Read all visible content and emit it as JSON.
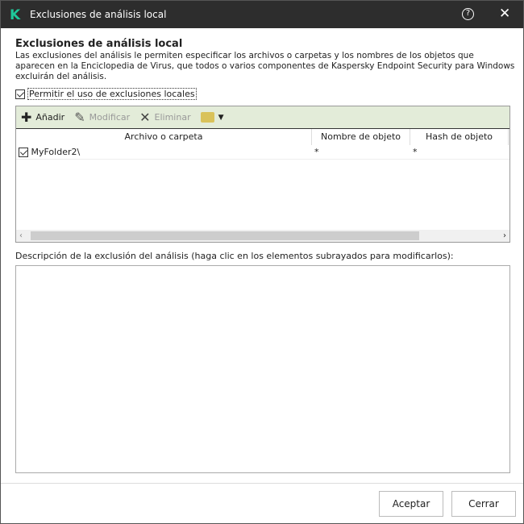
{
  "window": {
    "title": "Exclusiones de análisis local",
    "logo": "K"
  },
  "heading": "Exclusiones de análisis local",
  "description": "Las exclusiones del análisis le permiten especificar los archivos o carpetas y los nombres de los objetos que aparecen en la Enciclopedia de Virus, que todos o varios componentes de Kaspersky Endpoint Security para Windows excluirán del análisis.",
  "allow_checkbox": {
    "label": "Permitir el uso de exclusiones locales",
    "checked": true
  },
  "toolbar": {
    "add": "Añadir",
    "edit": "Modificar",
    "delete": "Eliminar"
  },
  "table": {
    "columns": [
      "Archivo o carpeta",
      "Nombre de objeto",
      "Hash de objeto"
    ],
    "rows": [
      {
        "checked": true,
        "path": "MyFolder2\\",
        "object": "*",
        "hash": "*"
      }
    ]
  },
  "description_label": "Descripción de la exclusión del análisis (haga clic en los elementos subrayados para modificarlos):",
  "buttons": {
    "ok": "Aceptar",
    "close": "Cerrar"
  }
}
